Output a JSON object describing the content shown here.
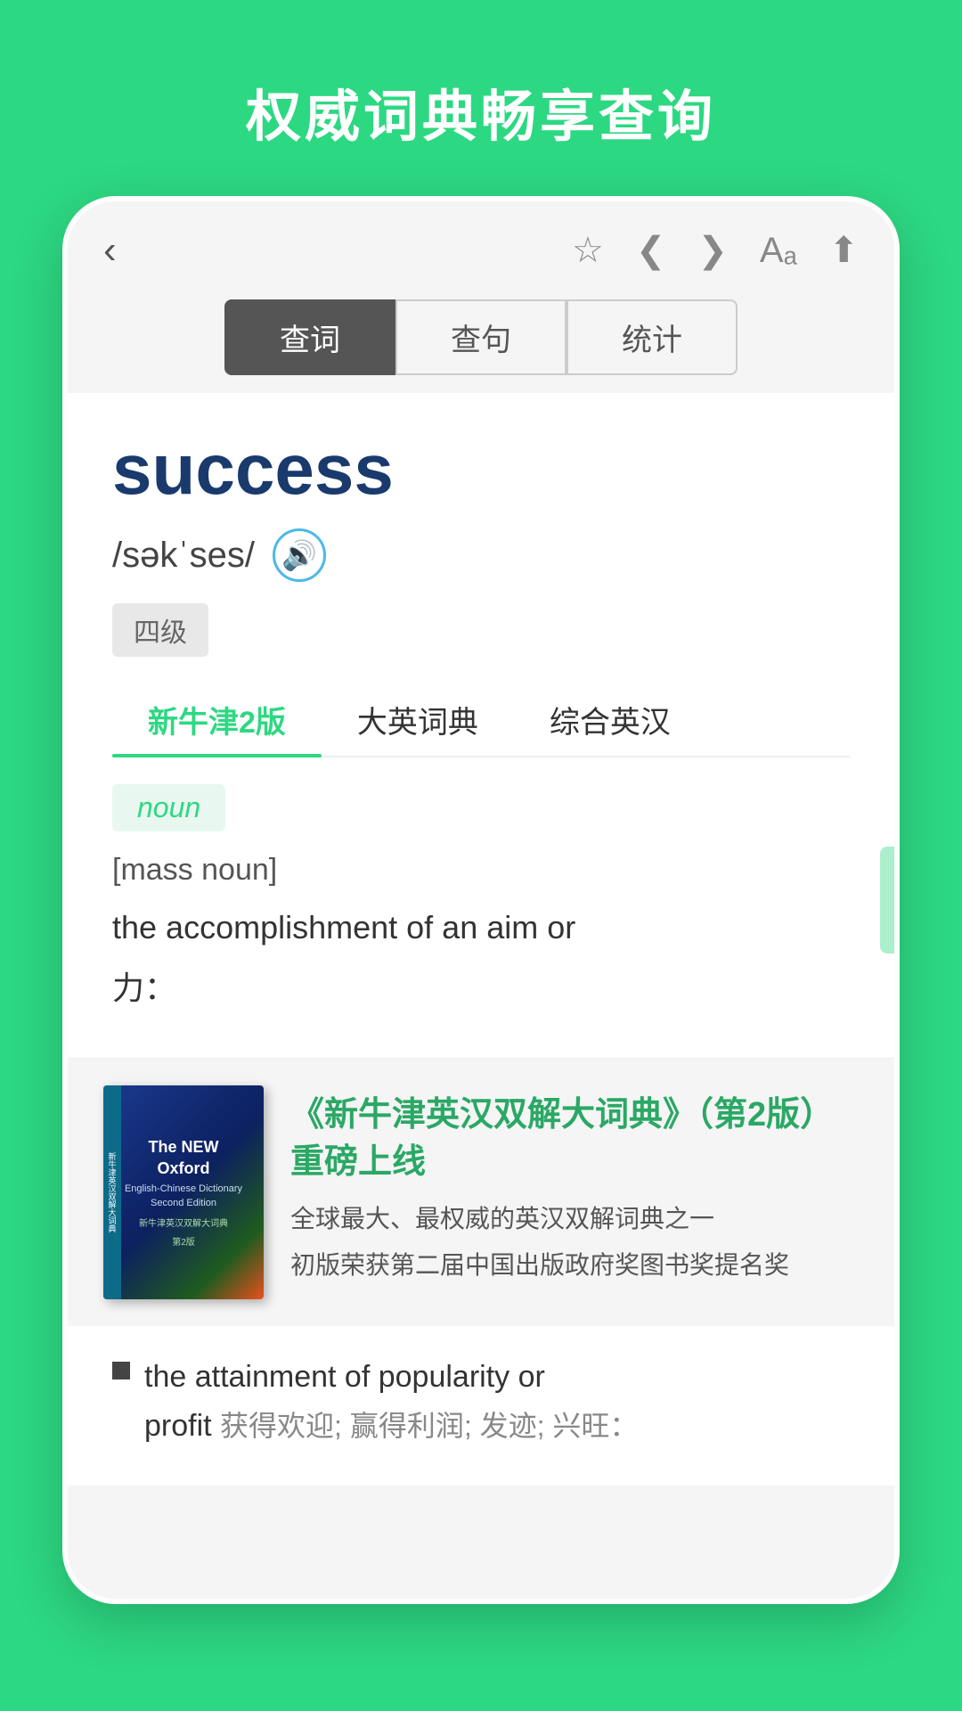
{
  "header": {
    "title": "权威词典畅享查询"
  },
  "toolbar": {
    "back_icon": "‹",
    "star_icon": "☆",
    "prev_icon": "❮",
    "next_icon": "❯",
    "font_icon": "Aₐ",
    "share_icon": "⬆"
  },
  "tabs": {
    "items": [
      {
        "label": "查词",
        "active": true
      },
      {
        "label": "查句",
        "active": false
      },
      {
        "label": "统计",
        "active": false
      }
    ]
  },
  "word": {
    "text": "success",
    "phonetic": "/səkˈses/",
    "level": "四级"
  },
  "dict_tabs": {
    "items": [
      {
        "label": "新牛津2版",
        "active": true
      },
      {
        "label": "大英词典",
        "active": false
      },
      {
        "label": "综合英汉",
        "active": false
      }
    ]
  },
  "definition": {
    "pos": "noun",
    "qualifier": "[mass noun]",
    "text1": "the accomplishment of an aim or",
    "text2": "力："
  },
  "promo": {
    "title": "《新牛津英汉双解大词典》（第2版）重磅上线",
    "desc1": "全球最大、最权威的英汉双解词典之一",
    "desc2": "初版荣获第二届中国出版政府奖图书奖提名奖",
    "book": {
      "title": "The NEW\nOxford",
      "subtitle": "English-Chinese Dictionary\nSecond Edition",
      "chinese_title": "新牛津英汉双解大词典",
      "edition": "第2版",
      "spine_text": "新牛津英汉双解大词典"
    }
  },
  "bottom_def": {
    "bullet_text": "the attainment of popularity or",
    "bullet_text2": "profit",
    "translation": "获得欢迎; 赢得利润; 发迹; 兴旺："
  }
}
